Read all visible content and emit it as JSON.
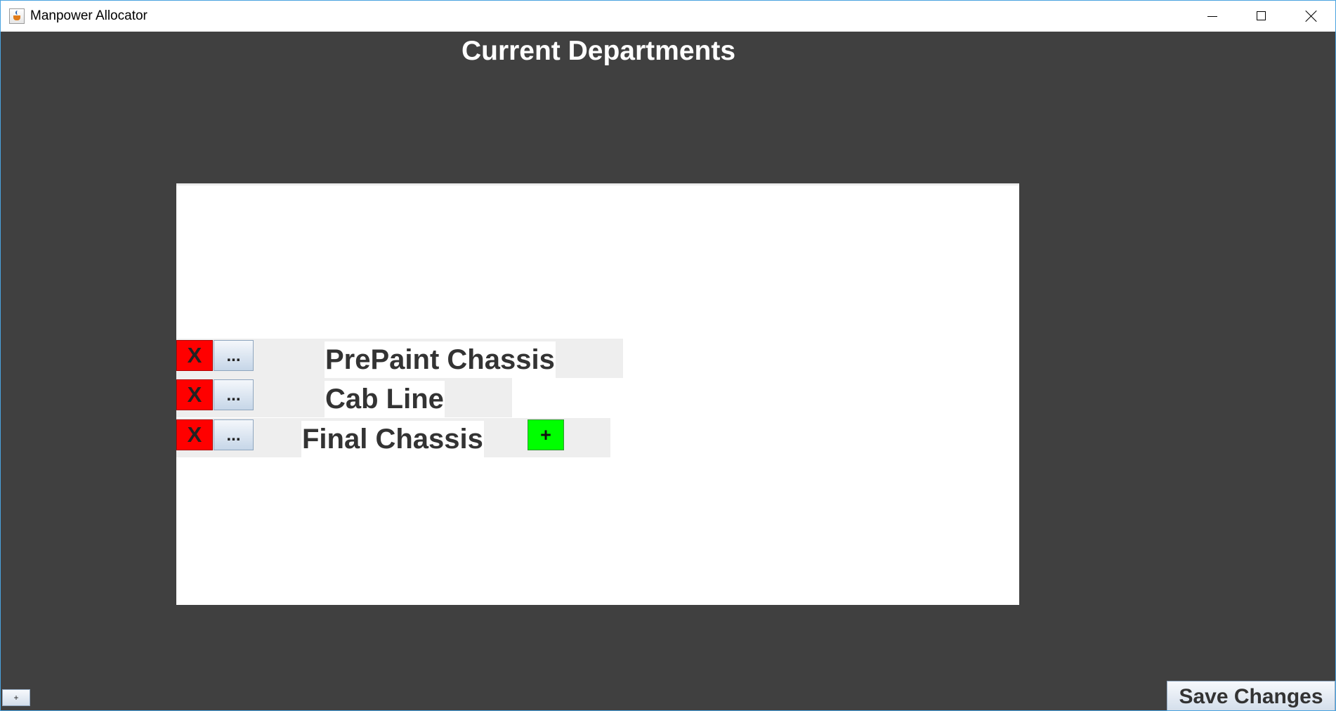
{
  "window": {
    "title": "Manpower Allocator",
    "app_icon": "java-cup-icon",
    "controls": [
      "minimize-icon",
      "maximize-icon",
      "close-icon"
    ]
  },
  "heading": "Current Departments",
  "departments": [
    {
      "name": "PrePaint Chassis",
      "delete_label": "X",
      "edit_label": "..."
    },
    {
      "name": "Cab Line",
      "delete_label": "X",
      "edit_label": "..."
    },
    {
      "name": "Final Chassis",
      "delete_label": "X",
      "edit_label": "..."
    }
  ],
  "add_department_label": "+",
  "small_add_label": "+",
  "save_label": "Save Changes",
  "colors": {
    "background": "#404040",
    "delete": "#ff0000",
    "add": "#00ff00",
    "panel": "#ffffff"
  }
}
